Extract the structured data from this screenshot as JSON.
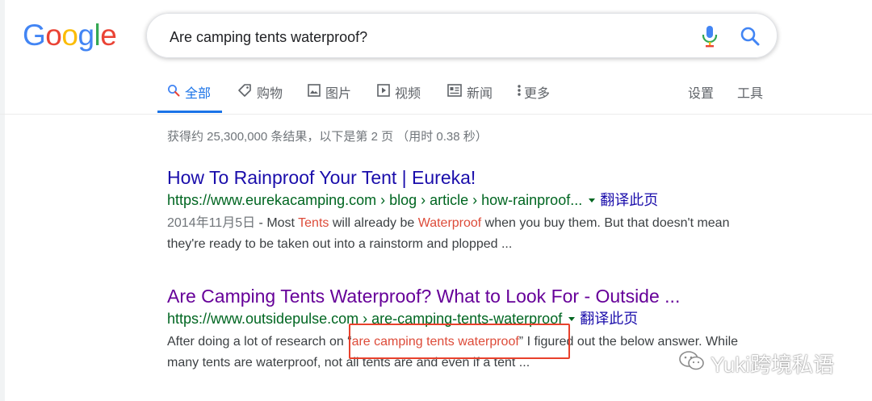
{
  "logo": {
    "letters": [
      "G",
      "o",
      "o",
      "g",
      "l",
      "e"
    ],
    "colors": [
      "#4285f4",
      "#ea4335",
      "#fbbc05",
      "#4285f4",
      "#34a853",
      "#ea4335"
    ]
  },
  "search": {
    "query": "Are camping tents waterproof?",
    "mic_icon": "mic-icon",
    "search_icon": "search-icon"
  },
  "tabs": [
    {
      "label": "全部",
      "icon": "search-icon",
      "active": true
    },
    {
      "label": "购物",
      "icon": "tag-icon"
    },
    {
      "label": "图片",
      "icon": "image-icon"
    },
    {
      "label": "视频",
      "icon": "play-icon"
    },
    {
      "label": "新闻",
      "icon": "news-icon"
    },
    {
      "label": "更多",
      "icon": "more-dots-icon"
    }
  ],
  "tools": {
    "settings": "设置",
    "tools": "工具"
  },
  "stats": "获得约 25,300,000 条结果，以下是第 2 页 （用时 0.38 秒）",
  "results": [
    {
      "title": "How To Rainproof Your Tent | Eureka!",
      "url": "https://www.eurekacamping.com › blog › article › how-rainproof...",
      "translate": "翻译此页",
      "snippet": {
        "date": "2014年11月5日",
        "sep": " - ",
        "parts": [
          "Most ",
          "Tents",
          " will already be ",
          "Waterproof",
          " when you buy them. But that doesn't mean they're ready to be taken out into a rainstorm and plopped ..."
        ]
      }
    },
    {
      "title": "Are Camping Tents Waterproof? What to Look For - Outside ...",
      "url": "https://www.outsidepulse.com › are-camping-tents-waterproof",
      "translate": "翻译此页",
      "snippet": {
        "parts": [
          "After doing a lot of research on “",
          "are camping tents waterproof",
          "” I figured out the below answer. While many tents are waterproof, not all tents are and even if a tent ..."
        ]
      }
    }
  ],
  "watermark": {
    "text": "Yuki跨境私语",
    "icon": "wechat-icon"
  },
  "accent": {
    "link_blue": "#1a0dab",
    "visited": "#660099",
    "url_green": "#006621",
    "highlight": "#dd4b39",
    "tab_active": "#1a73e8",
    "annotation_red": "#e8412c"
  }
}
